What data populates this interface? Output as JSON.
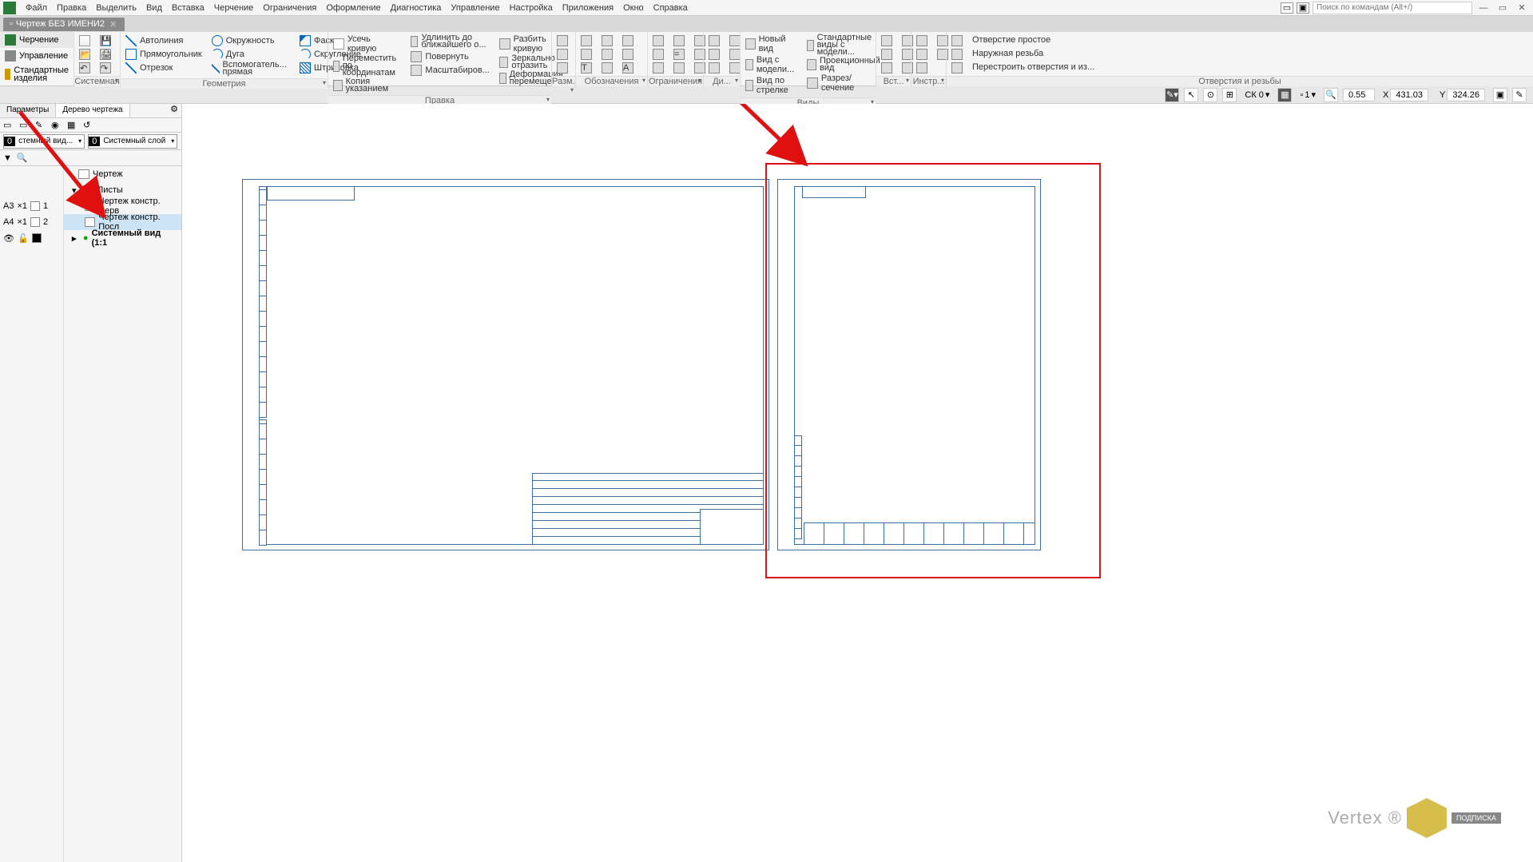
{
  "menu": [
    "Файл",
    "Правка",
    "Выделить",
    "Вид",
    "Вставка",
    "Черчение",
    "Ограничения",
    "Оформление",
    "Диагностика",
    "Управление",
    "Настройка",
    "Приложения",
    "Окно",
    "Справка"
  ],
  "search_placeholder": "Поиск по командам (Alt+/)",
  "tab_title": "Чертеж БЕЗ ИМЕНИ2",
  "ribbon_left": [
    {
      "label": "Черчение",
      "active": true
    },
    {
      "label": "Управление",
      "active": false
    },
    {
      "label": "Стандартные изделия",
      "active": false
    }
  ],
  "ribbon_groups": {
    "sys": "Системная",
    "geom": "Геометрия",
    "edit": "Правка",
    "dim": "Разм...",
    "mark": "Обозначения",
    "constr": "Ограничения",
    "diag": "Ди...",
    "views": "Виды",
    "insert": "Вст...",
    "tools": "Инстр...",
    "holes": "Отверстия и резьбы"
  },
  "ribbon_btns": {
    "autoline": "Автолиния",
    "circle": "Окружность",
    "chamfer": "Фаска",
    "rect": "Прямоугольник",
    "arc": "Дуга",
    "fillet": "Скругление",
    "segment": "Отрезок",
    "aux_line": "Вспомогатель... прямая",
    "hatch": "Штриховка",
    "trim": "Усечь кривую",
    "extend": "Удлинить до ближайшего о...",
    "split": "Разбить кривую",
    "move_coord": "Переместить по координатам",
    "copy_offset": "Копия указанием",
    "rotate": "Повернуть",
    "mirror": "Зеркально отразить",
    "scale": "Масштабиров...",
    "deform": "Деформация перемещением",
    "new_view": "Новый вид",
    "model_view": "Вид с модели...",
    "arrow_view": "Вид по стрелке",
    "std_views": "Стандартные виды с модели...",
    "proj_view": "Проекционный вид",
    "section": "Разрез/сечение",
    "simple_hole": "Отверстие простое",
    "thread": "Наружная резьба",
    "rebuild": "Перестроить отверстия и из..."
  },
  "statusbar": {
    "cs": "СК 0",
    "one": "1",
    "zoom": "0.55",
    "x_label": "X",
    "x": "431.03",
    "y_label": "Y",
    "y": "324.26"
  },
  "side": {
    "tab_params": "Параметры",
    "tab_tree": "Дерево чертежа",
    "dd1_num": "0",
    "dd1_txt": "стемный вид...",
    "dd2_num": "0",
    "dd2_txt": "Системный слой"
  },
  "tree": {
    "root": "Чертеж",
    "sheets": "Листы",
    "sheet1": "Чертеж констр. Перв",
    "sheet2": "Чертеж констр. Посл",
    "sysview": "Системный вид (1:1",
    "a3": "A3",
    "x1a": "×1",
    "n1": "1",
    "a4": "A4",
    "x1b": "×1",
    "n2": "2"
  },
  "watermark": {
    "text": "Vertex ®",
    "badge": "ПОДПИСКА"
  }
}
